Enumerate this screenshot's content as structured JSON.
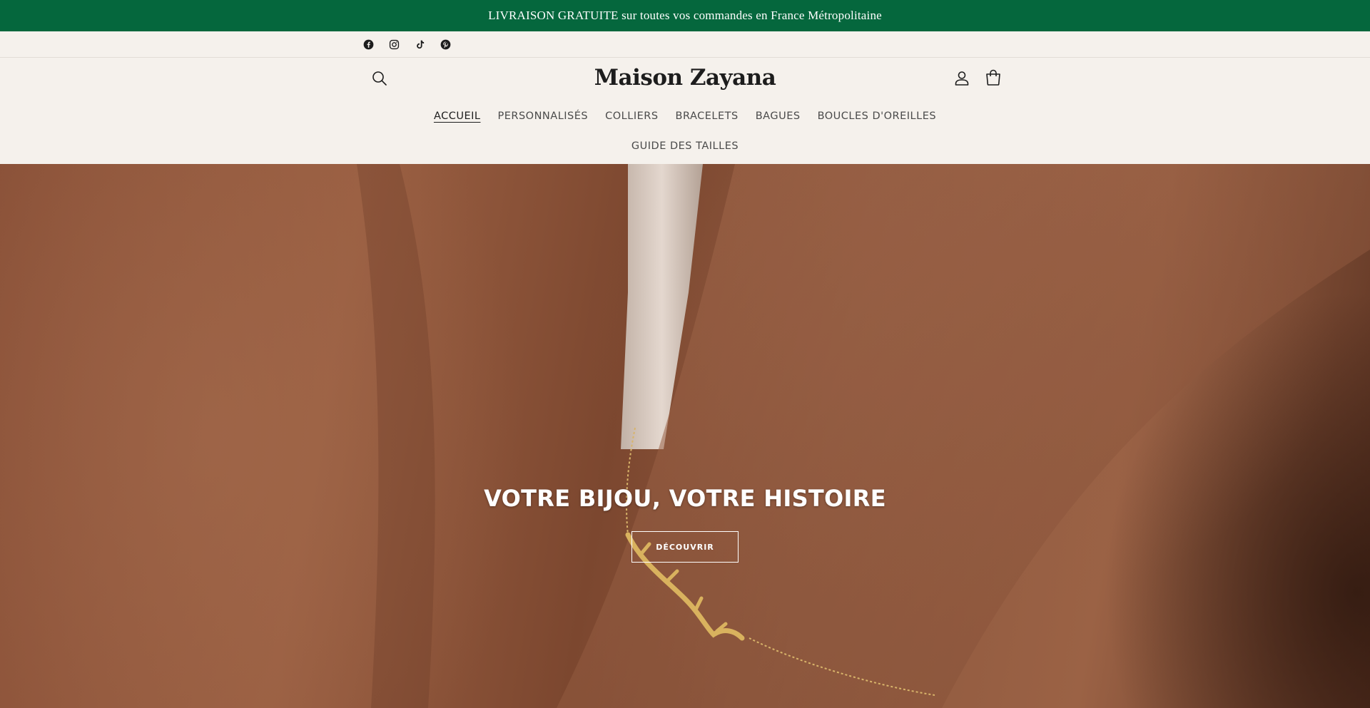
{
  "announcement": {
    "text": "LIVRAISON GRATUITE sur toutes vos commandes en France Métropolitaine"
  },
  "social": [
    {
      "name": "facebook-icon"
    },
    {
      "name": "instagram-icon"
    },
    {
      "name": "tiktok-icon"
    },
    {
      "name": "pinterest-icon"
    }
  ],
  "header": {
    "logo": "Maison Zayana",
    "search_icon": "search-icon",
    "account_icon": "account-icon",
    "cart_icon": "cart-icon"
  },
  "nav": {
    "items": [
      {
        "label": "ACCUEIL",
        "active": true
      },
      {
        "label": "PERSONNALISÉS"
      },
      {
        "label": "COLLIERS"
      },
      {
        "label": "BRACELETS"
      },
      {
        "label": "BAGUES"
      },
      {
        "label": "BOUCLES D'OREILLES"
      },
      {
        "label": "GUIDE DES TAILLES"
      }
    ]
  },
  "hero": {
    "title": "VOTRE BIJOU, VOTRE HISTOIRE",
    "cta": "DÉCOUVRIR"
  },
  "colors": {
    "announcement_bg": "#05673d",
    "header_bg": "#f5f1ec",
    "text": "#1d1d1d"
  }
}
